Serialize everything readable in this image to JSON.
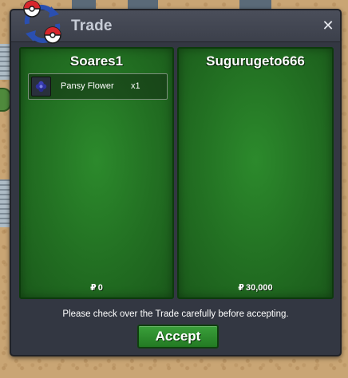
{
  "window": {
    "title": "Trade",
    "close_icon": "close-icon"
  },
  "logo": {
    "icon": "trade-pokeballs-icon"
  },
  "left_panel": {
    "player_name": "Soares1",
    "items": [
      {
        "icon": "pansy-flower-icon",
        "name": "Pansy Flower",
        "quantity": "x1"
      }
    ],
    "currency_symbol": "₽",
    "money": "0"
  },
  "right_panel": {
    "player_name": "Sugurugeto666",
    "items": [],
    "currency_symbol": "₽",
    "money": "30,000"
  },
  "footer": {
    "notice": "Please check over the Trade carefully before accepting.",
    "accept_label": "Accept"
  },
  "colors": {
    "panel_green": "#226f22",
    "accept_green": "#2f8f2f",
    "window_bg": "#333742"
  }
}
